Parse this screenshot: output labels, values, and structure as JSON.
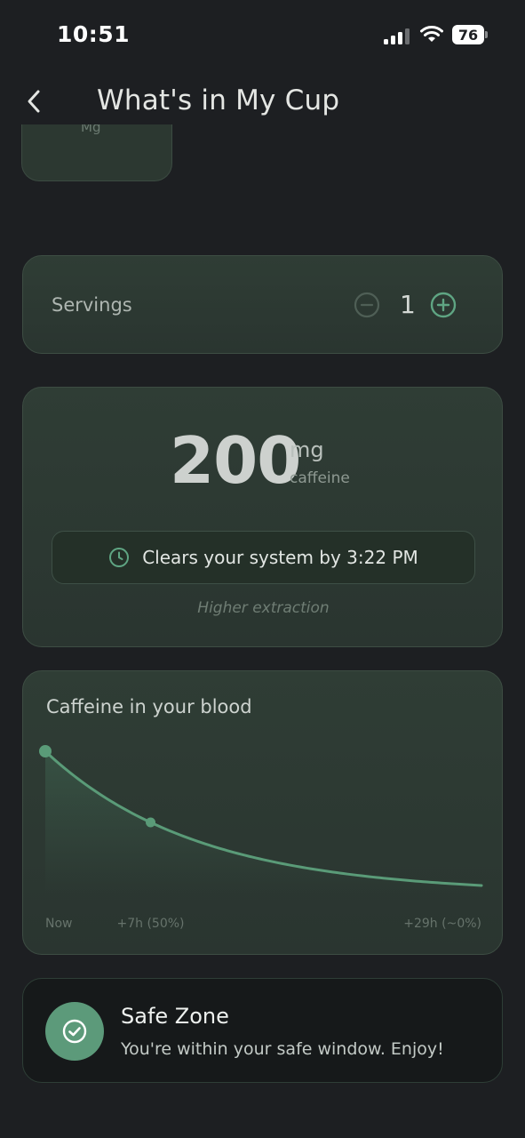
{
  "status_bar": {
    "time": "10:51",
    "battery": "76",
    "icons": [
      "cellular-signal-icon",
      "wifi-icon",
      "battery-icon"
    ]
  },
  "header": {
    "title": "What's in My Cup",
    "back_icon": "chevron-left-icon"
  },
  "partial_card": {
    "text": "Mg"
  },
  "servings": {
    "label": "Servings",
    "value": "1",
    "minus_icon": "minus-circle-icon",
    "plus_icon": "plus-circle-icon"
  },
  "caffeine": {
    "amount": "200",
    "unit": "mg",
    "sub_label": "caffeine",
    "clear_text": "Clears your system by 3:22 PM",
    "clock_icon": "clock-icon",
    "note": "Higher extraction"
  },
  "chart_data": {
    "type": "area",
    "title": "Caffeine in your blood",
    "x": [
      0,
      7,
      29
    ],
    "x_tick_labels": [
      "Now",
      "+7h (50%)",
      "+29h (~0%)"
    ],
    "values_percent": [
      100,
      50,
      0
    ],
    "highlighted_points": [
      0,
      7
    ],
    "curve": "exponential-decay",
    "half_life_hours": 7,
    "grid": false,
    "legend": "none",
    "accent_color": "#5a9b78"
  },
  "safe_zone": {
    "title": "Safe Zone",
    "message": "You're within your safe window. Enjoy!",
    "icon": "check-circle-icon",
    "color": "#5c9a7a"
  },
  "colors": {
    "background": "#1d1f22",
    "card": "#2e3b34",
    "accent": "#5a9b78"
  }
}
